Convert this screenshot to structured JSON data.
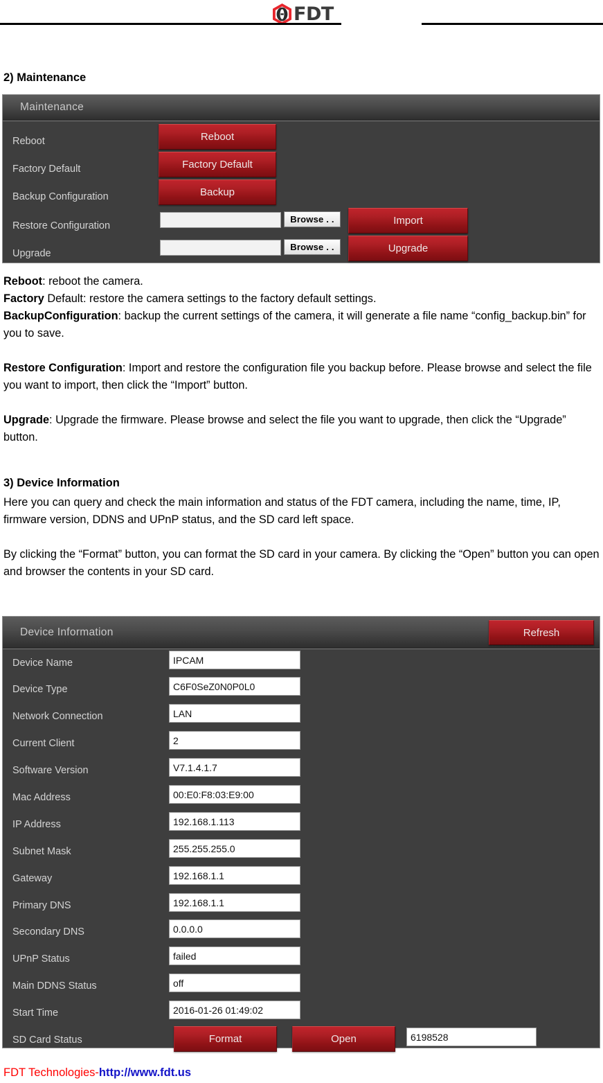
{
  "header": {
    "logo_icon": "fdt-hexagon-logo-icon",
    "logo_text": "FDT"
  },
  "maintenance_section": {
    "heading": "2) Maintenance",
    "panel": {
      "title": "Maintenance",
      "rows": [
        {
          "label": "Reboot",
          "button": "Reboot"
        },
        {
          "label": "Factory Default",
          "button": "Factory Default"
        },
        {
          "label": "Backup Configuration",
          "button": "Backup"
        },
        {
          "label": "Restore Configuration",
          "field_value": "",
          "browse": "Browse . .",
          "button": "Import"
        },
        {
          "label": "Upgrade",
          "field_value": "",
          "browse": "Browse . .",
          "button": "Upgrade"
        }
      ]
    },
    "descriptions": [
      {
        "bold": "Reboot",
        "rest": ": reboot the camera."
      },
      {
        "bold": "Factory",
        "rest": " Default: restore the camera settings to the factory default settings."
      },
      {
        "bold": "BackupConfiguration",
        "rest": ": backup the current settings of the camera, it will generate a file name “config_backup.bin” for you to save."
      },
      {
        "bold": "Restore Configuration",
        "rest": ": Import and restore the configuration file you backup before. Please browse and select the file you want to import, then click the “Import” button."
      },
      {
        "bold": "Upgrade",
        "rest": ": Upgrade the firmware. Please browse and select the file you want to upgrade, then click the “Upgrade” button."
      }
    ]
  },
  "device_section": {
    "heading": "3) Device Information",
    "paragraphs": [
      "Here you can query and check the main information and status of the FDT camera, including the name, time, IP, firmware version, DDNS and UPnP status, and the SD card left space.",
      "By clicking the “Format” button, you can format the SD card in your camera. By clicking the “Open” button you can open and browser the contents in your SD card."
    ],
    "panel": {
      "title": "Device Information",
      "refresh_label": "Refresh",
      "rows": [
        {
          "label": "Device Name",
          "value": "IPCAM"
        },
        {
          "label": "Device Type",
          "value": "C6F0SeZ0N0P0L0"
        },
        {
          "label": "Network Connection",
          "value": "LAN"
        },
        {
          "label": "Current Client",
          "value": "2"
        },
        {
          "label": "Software Version",
          "value": "V7.1.4.1.7"
        },
        {
          "label": "Mac Address",
          "value": "00:E0:F8:03:E9:00"
        },
        {
          "label": "IP Address",
          "value": "192.168.1.113"
        },
        {
          "label": "Subnet Mask",
          "value": "255.255.255.0"
        },
        {
          "label": "Gateway",
          "value": "192.168.1.1"
        },
        {
          "label": "Primary DNS",
          "value": "192.168.1.1"
        },
        {
          "label": "Secondary DNS",
          "value": "0.0.0.0"
        },
        {
          "label": "UPnP Status",
          "value": "failed"
        },
        {
          "label": "Main DDNS Status",
          "value": "off"
        },
        {
          "label": "Start Time",
          "value": "2016-01-26 01:49:02"
        }
      ],
      "sd_row": {
        "label": "SD Card Status",
        "format_label": "Format",
        "open_label": "Open",
        "value": "6198528"
      }
    }
  },
  "footer": {
    "company": "FDT Technologies-",
    "url": "http://www.fdt.us"
  },
  "colors": {
    "button_red": "#ae1f25",
    "panel_body": "#3e3e3e",
    "panel_title_text": "#c9c9c9",
    "footer_company": "#ff0000",
    "footer_url": "#1414c8"
  }
}
